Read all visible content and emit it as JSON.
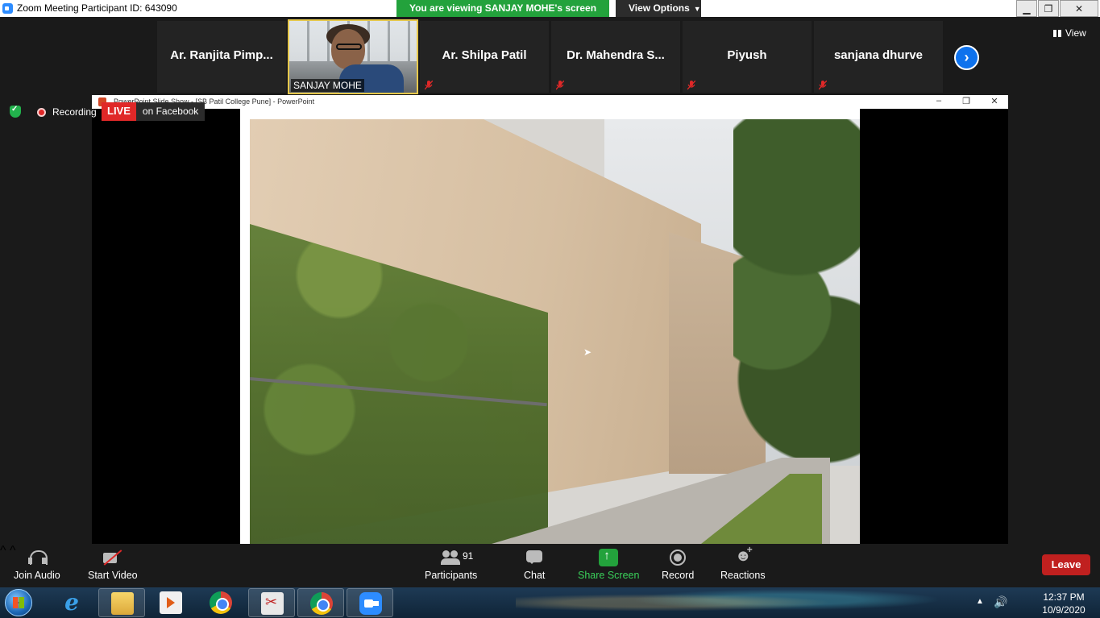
{
  "titlebar": {
    "title": "Zoom Meeting Participant ID: 643090",
    "viewing_banner": "You are viewing SANJAY MOHE's screen",
    "view_options": "View Options",
    "minimize": "▁",
    "restore": "❐",
    "close": "✕"
  },
  "participants_strip": {
    "tiles": [
      {
        "name": "Ar. Ranjita Pimp..."
      },
      {
        "name": "Ar. Shilpa Patil"
      },
      {
        "name": "Dr. Mahendra S..."
      },
      {
        "name": "Piyush"
      },
      {
        "name": "sanjana dhurve"
      }
    ],
    "video_tile_name": "SANJAY MOHE",
    "next_page": "›",
    "view_label": "View"
  },
  "status": {
    "recording_label": "Recording",
    "live_label": "LIVE",
    "live_target": "on Facebook"
  },
  "shared_screen": {
    "window_title": "PowerPoint Slide Show - [SB Patil College Pune] - PowerPoint",
    "minimize": "–",
    "restore": "❐",
    "close": "✕"
  },
  "toolbar": {
    "join_audio": "Join Audio",
    "start_video": "Start Video",
    "participants": "Participants",
    "participants_count": "91",
    "chat": "Chat",
    "share_screen": "Share Screen",
    "record": "Record",
    "reactions": "Reactions",
    "leave": "Leave",
    "caret": "^"
  },
  "taskbar": {
    "time": "12:37 PM",
    "date": "10/9/2020",
    "tray_up": "▲",
    "volume": "🔊",
    "apps": [
      "internet-explorer",
      "file-explorer",
      "media-player",
      "chrome",
      "snipping-tool",
      "chrome",
      "zoom"
    ]
  },
  "colors": {
    "viewing_banner": "#23a23c",
    "leave": "#c0201f",
    "live": "#e02828",
    "next_button": "#0e72ed",
    "active_speaker_border": "#e6c84b"
  }
}
